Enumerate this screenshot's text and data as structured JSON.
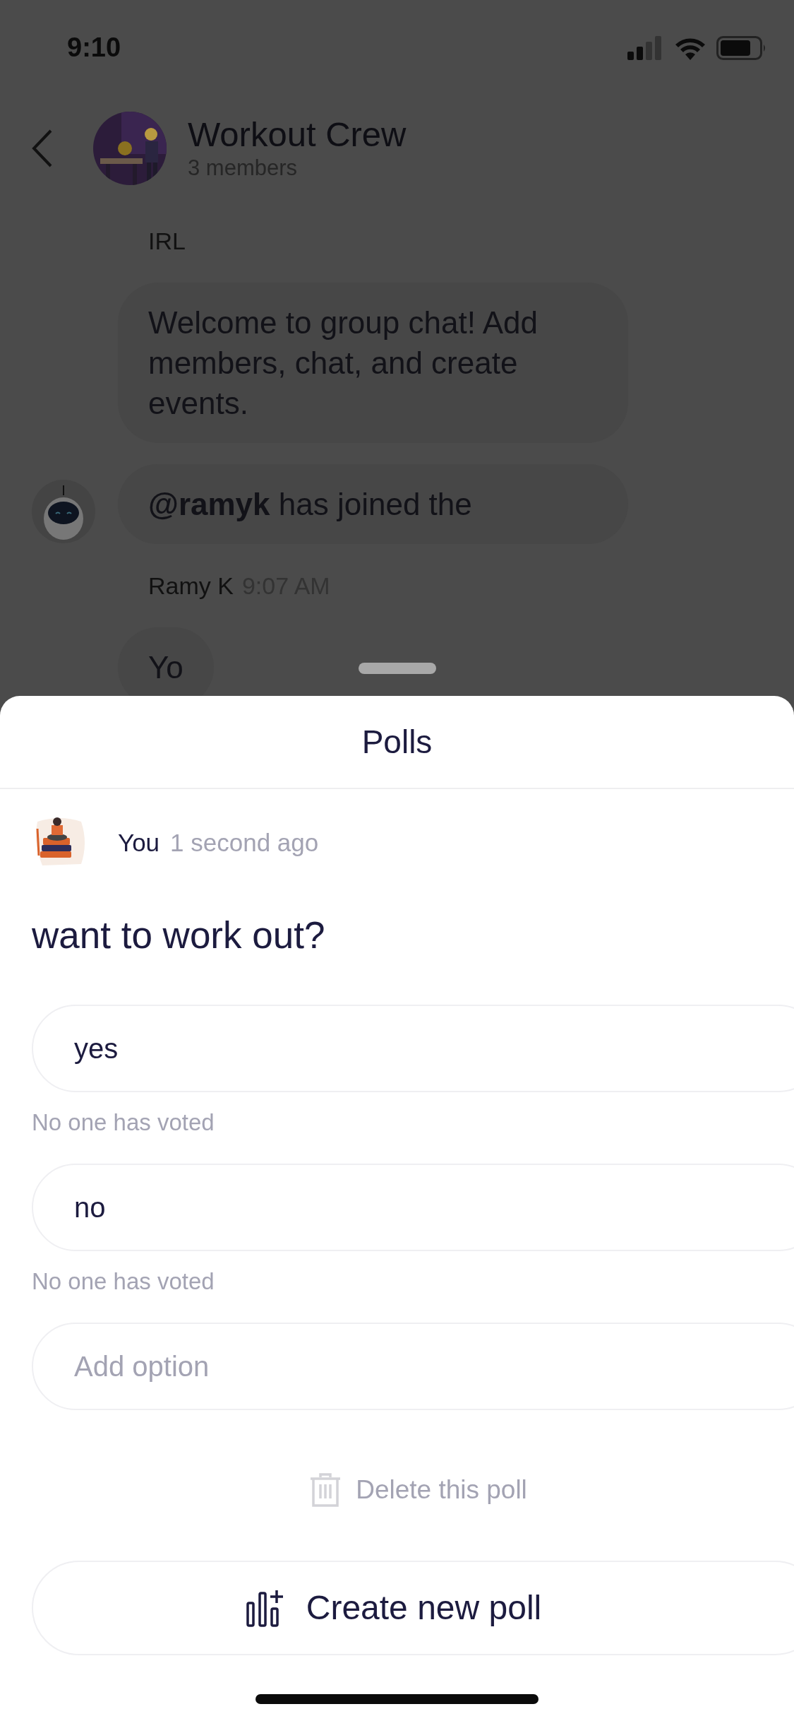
{
  "status_bar": {
    "time": "9:10"
  },
  "header": {
    "title": "Workout Crew",
    "subtitle": "3 members"
  },
  "messages": [
    {
      "kind": "sender",
      "name": "IRL"
    },
    {
      "kind": "bubble",
      "text": "Welcome to group chat! Add members, chat, and create events.",
      "avatar": false
    },
    {
      "kind": "bubble",
      "text": "**@ramyk** has joined the",
      "avatar": true
    },
    {
      "kind": "sender",
      "name": "Ramy K",
      "time": "9:07 AM"
    },
    {
      "kind": "bubble",
      "text": "Yo",
      "avatar": false
    }
  ],
  "sheet": {
    "title": "Polls",
    "poll": {
      "author": "You",
      "time": "1 second ago",
      "question": "want to work out?",
      "options": [
        {
          "label": "yes",
          "votes": "No one has voted"
        },
        {
          "label": "no",
          "votes": "No one has voted"
        }
      ],
      "add_option": {
        "placeholder": "Add option"
      },
      "delete_label": "Delete this poll"
    },
    "create_label": "Create new poll"
  }
}
